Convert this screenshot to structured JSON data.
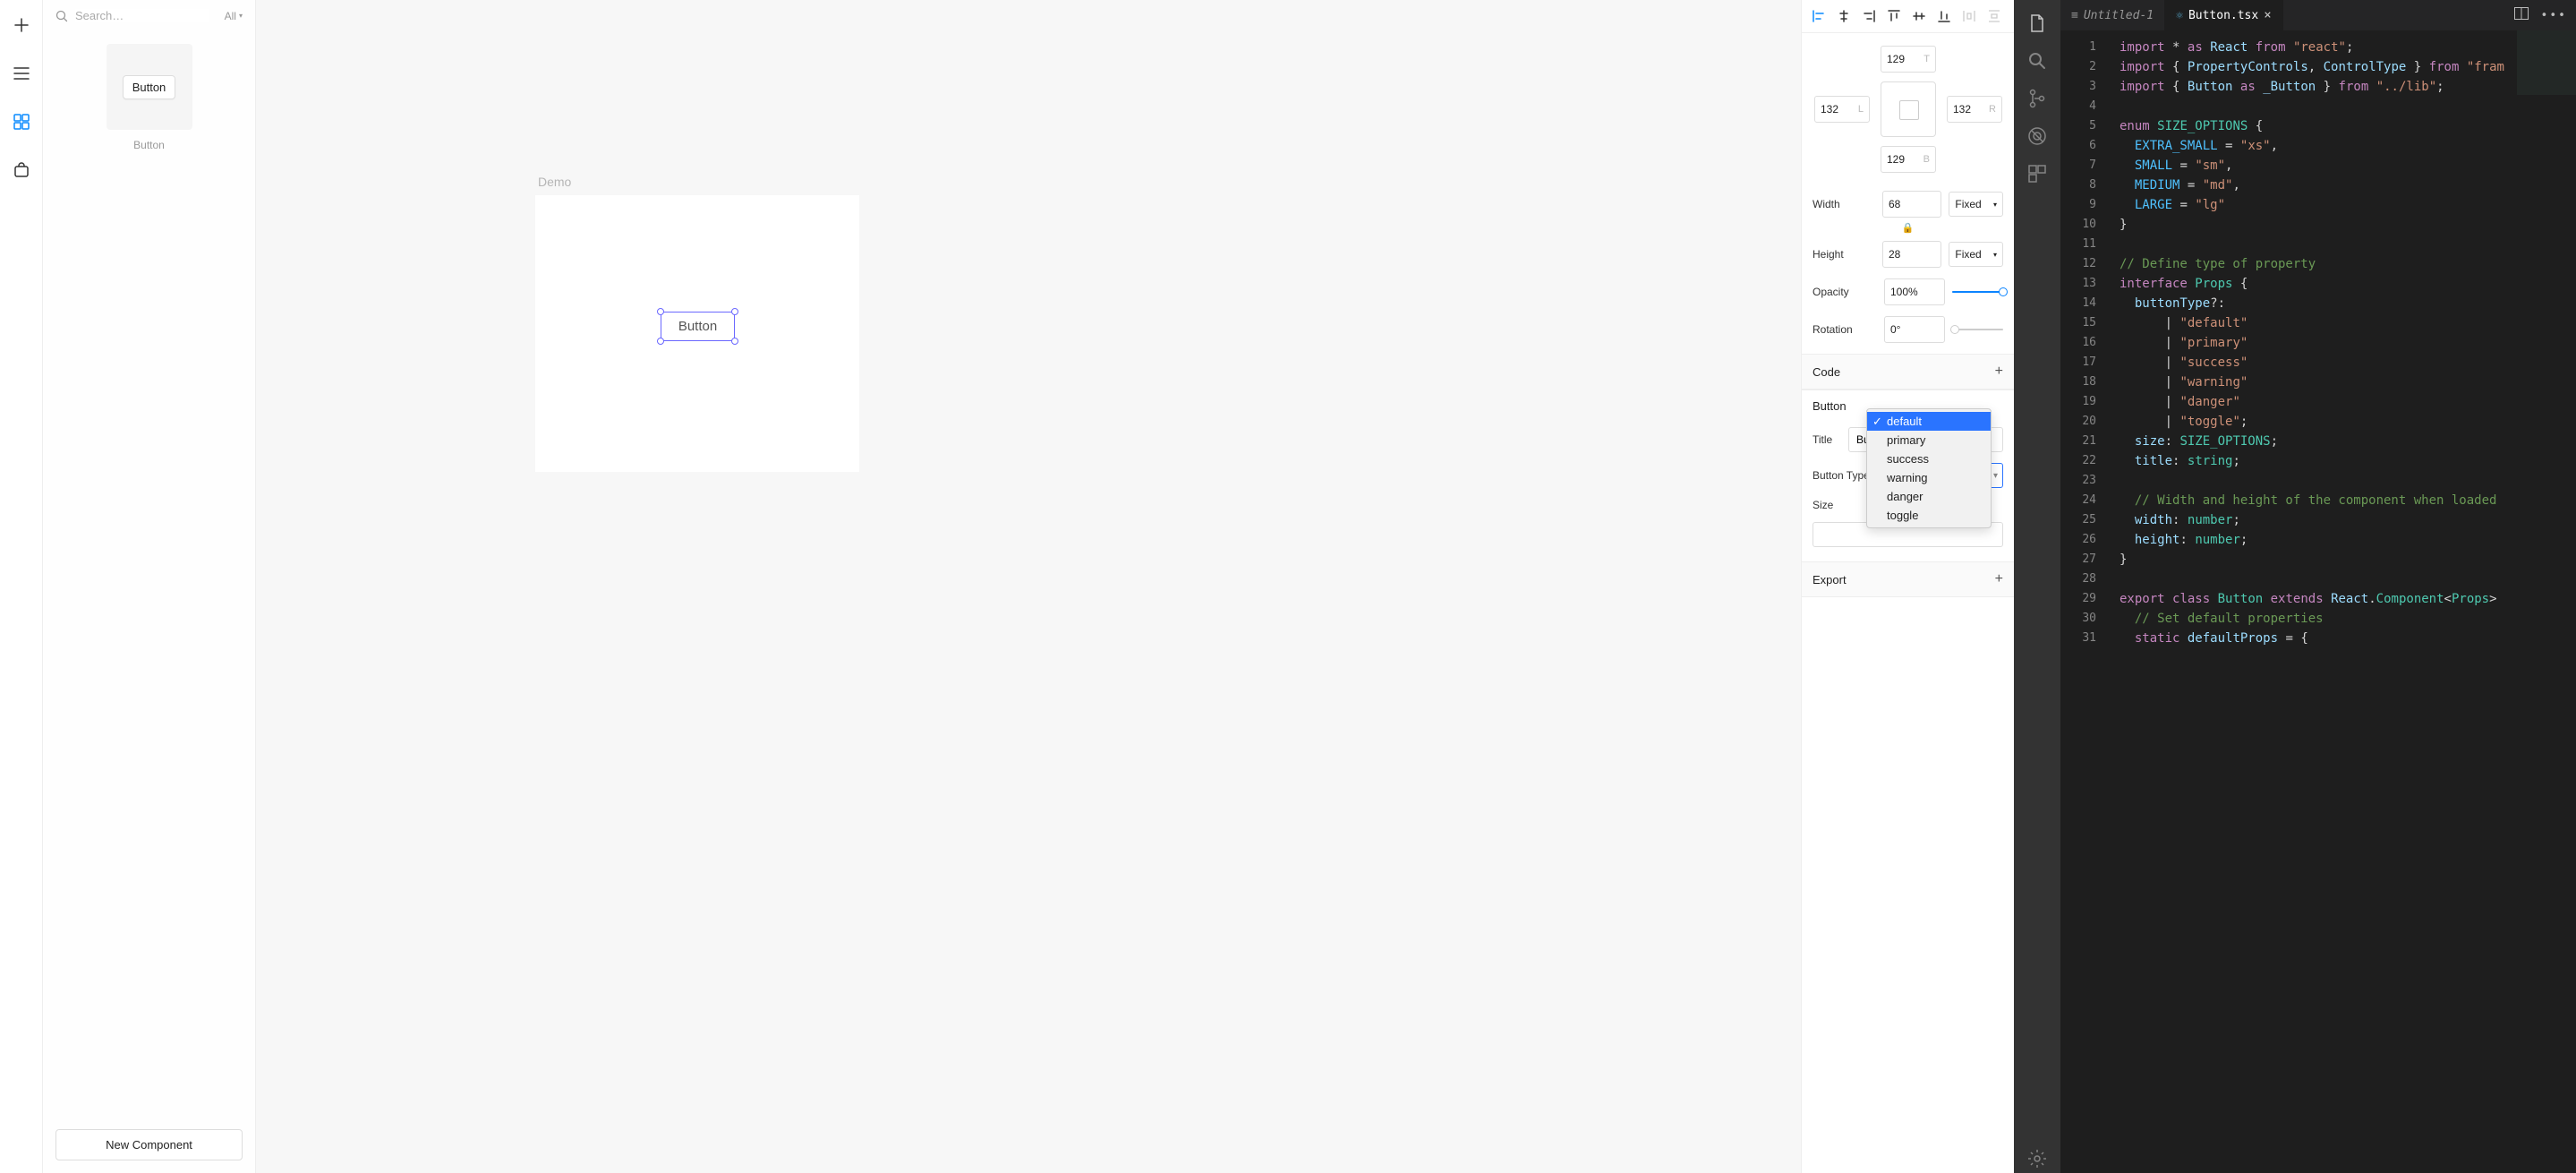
{
  "toolstrip": {
    "icons": [
      "plus-icon",
      "menu-icon",
      "grid-icon",
      "bag-icon"
    ]
  },
  "search": {
    "placeholder": "Search…",
    "filter": "All"
  },
  "components": {
    "items": [
      {
        "label": "Button",
        "thumb_text": "Button"
      }
    ]
  },
  "new_component_label": "New Component",
  "canvas": {
    "frame_label": "Demo",
    "selected_text": "Button"
  },
  "align": {
    "icons": [
      "align-left",
      "align-center-h",
      "align-right",
      "align-top",
      "align-center-v",
      "align-bottom",
      "distribute-h",
      "distribute-v"
    ]
  },
  "layout": {
    "top": "129",
    "left": "132",
    "right": "132",
    "bottom": "129",
    "top_lbl": "T",
    "left_lbl": "L",
    "right_lbl": "R",
    "bottom_lbl": "B"
  },
  "size": {
    "width_label": "Width",
    "width": "68",
    "width_mode": "Fixed",
    "height_label": "Height",
    "height": "28",
    "height_mode": "Fixed"
  },
  "opacity": {
    "label": "Opacity",
    "value": "100%",
    "pct": 100
  },
  "rotation": {
    "label": "Rotation",
    "value": "0°",
    "pct": 0
  },
  "sections": {
    "code": "Code",
    "button": "Button",
    "export": "Export"
  },
  "button_props": {
    "title_label": "Title",
    "title_value": "Button",
    "type_label": "Button Type",
    "type_options": [
      "default",
      "primary",
      "success",
      "warning",
      "danger",
      "toggle"
    ],
    "type_selected": "default",
    "size_label": "Size"
  },
  "editor": {
    "tabs": [
      {
        "name": "Untitled-1",
        "icon": "≡",
        "active": false,
        "italic": true
      },
      {
        "name": "Button.tsx",
        "icon": "⚛",
        "active": true,
        "italic": false
      }
    ],
    "lines": [
      {
        "n": 1,
        "html": "<span class='tok-op'>import</span> <span class='tok-punc'>*</span> <span class='tok-op'>as</span> <span class='tok-var'>React</span> <span class='tok-op'>from</span> <span class='tok-str'>\"react\"</span><span class='tok-punc'>;</span>"
      },
      {
        "n": 2,
        "html": "<span class='tok-op'>import</span> <span class='tok-punc'>{</span> <span class='tok-var'>PropertyControls</span><span class='tok-punc'>,</span> <span class='tok-var'>ControlType</span> <span class='tok-punc'>}</span> <span class='tok-op'>from</span> <span class='tok-str'>\"fram</span>"
      },
      {
        "n": 3,
        "html": "<span class='tok-op'>import</span> <span class='tok-punc'>{</span> <span class='tok-var'>Button</span> <span class='tok-op'>as</span> <span class='tok-var'>_Button</span> <span class='tok-punc'>}</span> <span class='tok-op'>from</span> <span class='tok-str'>\"../lib\"</span><span class='tok-punc'>;</span>"
      },
      {
        "n": 4,
        "html": ""
      },
      {
        "n": 5,
        "html": "<span class='tok-kw'>enum</span> <span class='tok-type'>SIZE_OPTIONS</span> <span class='tok-punc'>{</span>"
      },
      {
        "n": 6,
        "html": "  <span class='tok-enum'>EXTRA_SMALL</span> <span class='tok-punc'>=</span> <span class='tok-str'>\"xs\"</span><span class='tok-punc'>,</span>"
      },
      {
        "n": 7,
        "html": "  <span class='tok-enum'>SMALL</span> <span class='tok-punc'>=</span> <span class='tok-str'>\"sm\"</span><span class='tok-punc'>,</span>"
      },
      {
        "n": 8,
        "html": "  <span class='tok-enum'>MEDIUM</span> <span class='tok-punc'>=</span> <span class='tok-str'>\"md\"</span><span class='tok-punc'>,</span>"
      },
      {
        "n": 9,
        "html": "  <span class='tok-enum'>LARGE</span> <span class='tok-punc'>=</span> <span class='tok-str'>\"lg\"</span>"
      },
      {
        "n": 10,
        "html": "<span class='tok-punc'>}</span>"
      },
      {
        "n": 11,
        "html": ""
      },
      {
        "n": 12,
        "html": "<span class='tok-comment'>// Define type of property</span>"
      },
      {
        "n": 13,
        "html": "<span class='tok-kw'>interface</span> <span class='tok-type'>Props</span> <span class='tok-punc'>{</span>"
      },
      {
        "n": 14,
        "html": "  <span class='tok-var'>buttonType</span><span class='tok-punc'>?:</span>"
      },
      {
        "n": 15,
        "html": "      <span class='tok-punc'>|</span> <span class='tok-str'>\"default\"</span>"
      },
      {
        "n": 16,
        "html": "      <span class='tok-punc'>|</span> <span class='tok-str'>\"primary\"</span>"
      },
      {
        "n": 17,
        "html": "      <span class='tok-punc'>|</span> <span class='tok-str'>\"success\"</span>"
      },
      {
        "n": 18,
        "html": "      <span class='tok-punc'>|</span> <span class='tok-str'>\"warning\"</span>"
      },
      {
        "n": 19,
        "html": "      <span class='tok-punc'>|</span> <span class='tok-str'>\"danger\"</span>"
      },
      {
        "n": 20,
        "html": "      <span class='tok-punc'>|</span> <span class='tok-str'>\"toggle\"</span><span class='tok-punc'>;</span>"
      },
      {
        "n": 21,
        "html": "  <span class='tok-var'>size</span><span class='tok-punc'>:</span> <span class='tok-type'>SIZE_OPTIONS</span><span class='tok-punc'>;</span>"
      },
      {
        "n": 22,
        "html": "  <span class='tok-var'>title</span><span class='tok-punc'>:</span> <span class='tok-type'>string</span><span class='tok-punc'>;</span>"
      },
      {
        "n": 23,
        "html": ""
      },
      {
        "n": 24,
        "html": "  <span class='tok-comment'>// Width and height of the component when loaded</span>"
      },
      {
        "n": 25,
        "html": "  <span class='tok-var'>width</span><span class='tok-punc'>:</span> <span class='tok-type'>number</span><span class='tok-punc'>;</span>"
      },
      {
        "n": 26,
        "html": "  <span class='tok-var'>height</span><span class='tok-punc'>:</span> <span class='tok-type'>number</span><span class='tok-punc'>;</span>"
      },
      {
        "n": 27,
        "html": "<span class='tok-punc'>}</span>"
      },
      {
        "n": 28,
        "html": ""
      },
      {
        "n": 29,
        "html": "<span class='tok-op'>export</span> <span class='tok-kw'>class</span> <span class='tok-type'>Button</span> <span class='tok-kw'>extends</span> <span class='tok-var'>React</span><span class='tok-punc'>.</span><span class='tok-type'>Component</span><span class='tok-punc'>&lt;</span><span class='tok-type'>Props</span><span class='tok-punc'>&gt;</span>"
      },
      {
        "n": 30,
        "html": "  <span class='tok-comment'>// Set default properties</span>"
      },
      {
        "n": 31,
        "html": "  <span class='tok-kw'>static</span> <span class='tok-var'>defaultProps</span> <span class='tok-punc'>=</span> <span class='tok-punc'>{</span>"
      }
    ]
  }
}
